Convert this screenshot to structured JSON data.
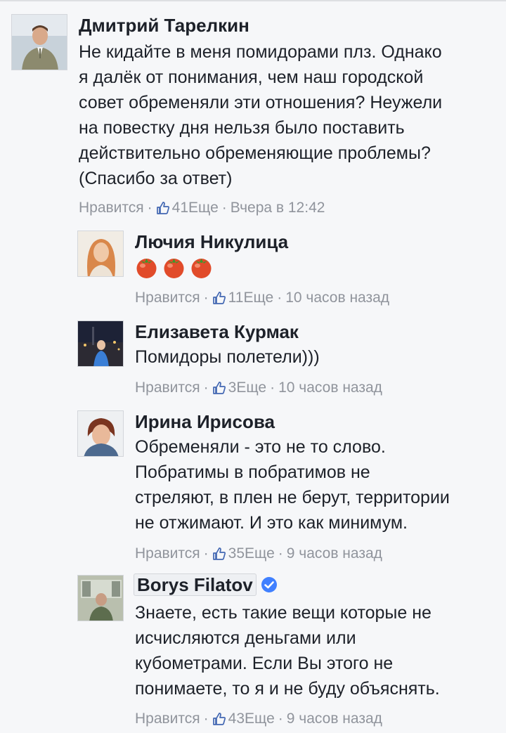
{
  "colors": {
    "background": "#f6f7f9",
    "name": "#1d2129",
    "meta": "#90949c",
    "like": "#4267b2",
    "verified": "#4080ff"
  },
  "comments": [
    {
      "author": "Дмитрий Тарелкин",
      "lines": [
        "Не кидайте в меня помидорами плз. Однако",
        "я далёк от понимания, чем наш городской",
        "совет обременяли эти отношения? Неужели",
        "на повестку дня нельзя было поставить",
        "действительно обременяющие проблемы?",
        "(Спасибо за ответ)"
      ],
      "like_label": "Нравится",
      "likes": "41",
      "more": "Еще",
      "time": "Вчера в 12:42"
    },
    {
      "author": "Лючия Никулица",
      "emoji": [
        "tomato-icon",
        "tomato-icon",
        "tomato-icon"
      ],
      "like_label": "Нравится",
      "likes": "11",
      "more": "Еще",
      "time": "10 часов назад"
    },
    {
      "author": "Елизавета Курмак",
      "lines": [
        "Помидоры полетели)))"
      ],
      "like_label": "Нравится",
      "likes": "3",
      "more": "Еще",
      "time": "10 часов назад"
    },
    {
      "author": "Ирина Ирисова",
      "lines": [
        "Обременяли - это не то слово.",
        "Побратимы в побратимов не",
        "стреляют, в плен не берут, территории",
        "не отжимают. И это как минимум."
      ],
      "like_label": "Нравится",
      "likes": "35",
      "more": "Еще",
      "time": "9 часов назад"
    },
    {
      "author": "Borys Filatov",
      "verified": true,
      "lines": [
        "Знаете, есть такие вещи которые не",
        "исчисляются деньгами или",
        "кубометрами. Если Вы этого не",
        "понимаете, то я и не буду объяснять."
      ],
      "like_label": "Нравится",
      "likes": "43",
      "more": "Еще",
      "time": "9 часов назад"
    }
  ]
}
